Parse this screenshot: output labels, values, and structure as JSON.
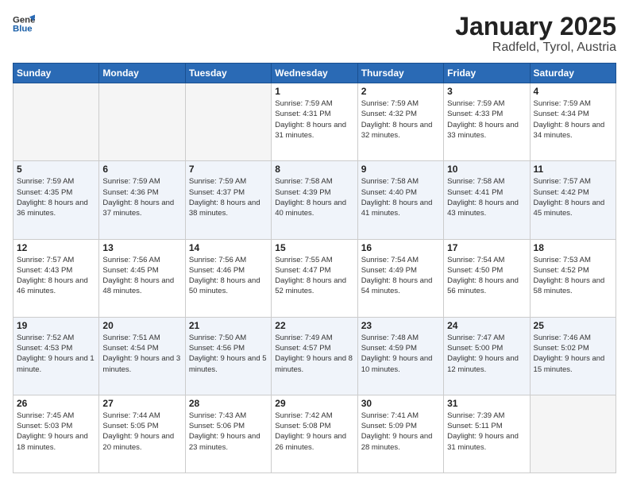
{
  "header": {
    "logo_line1": "General",
    "logo_line2": "Blue",
    "title": "January 2025",
    "subtitle": "Radfeld, Tyrol, Austria"
  },
  "days_of_week": [
    "Sunday",
    "Monday",
    "Tuesday",
    "Wednesday",
    "Thursday",
    "Friday",
    "Saturday"
  ],
  "weeks": [
    [
      {
        "day": "",
        "info": ""
      },
      {
        "day": "",
        "info": ""
      },
      {
        "day": "",
        "info": ""
      },
      {
        "day": "1",
        "info": "Sunrise: 7:59 AM\nSunset: 4:31 PM\nDaylight: 8 hours\nand 31 minutes."
      },
      {
        "day": "2",
        "info": "Sunrise: 7:59 AM\nSunset: 4:32 PM\nDaylight: 8 hours\nand 32 minutes."
      },
      {
        "day": "3",
        "info": "Sunrise: 7:59 AM\nSunset: 4:33 PM\nDaylight: 8 hours\nand 33 minutes."
      },
      {
        "day": "4",
        "info": "Sunrise: 7:59 AM\nSunset: 4:34 PM\nDaylight: 8 hours\nand 34 minutes."
      }
    ],
    [
      {
        "day": "5",
        "info": "Sunrise: 7:59 AM\nSunset: 4:35 PM\nDaylight: 8 hours\nand 36 minutes."
      },
      {
        "day": "6",
        "info": "Sunrise: 7:59 AM\nSunset: 4:36 PM\nDaylight: 8 hours\nand 37 minutes."
      },
      {
        "day": "7",
        "info": "Sunrise: 7:59 AM\nSunset: 4:37 PM\nDaylight: 8 hours\nand 38 minutes."
      },
      {
        "day": "8",
        "info": "Sunrise: 7:58 AM\nSunset: 4:39 PM\nDaylight: 8 hours\nand 40 minutes."
      },
      {
        "day": "9",
        "info": "Sunrise: 7:58 AM\nSunset: 4:40 PM\nDaylight: 8 hours\nand 41 minutes."
      },
      {
        "day": "10",
        "info": "Sunrise: 7:58 AM\nSunset: 4:41 PM\nDaylight: 8 hours\nand 43 minutes."
      },
      {
        "day": "11",
        "info": "Sunrise: 7:57 AM\nSunset: 4:42 PM\nDaylight: 8 hours\nand 45 minutes."
      }
    ],
    [
      {
        "day": "12",
        "info": "Sunrise: 7:57 AM\nSunset: 4:43 PM\nDaylight: 8 hours\nand 46 minutes."
      },
      {
        "day": "13",
        "info": "Sunrise: 7:56 AM\nSunset: 4:45 PM\nDaylight: 8 hours\nand 48 minutes."
      },
      {
        "day": "14",
        "info": "Sunrise: 7:56 AM\nSunset: 4:46 PM\nDaylight: 8 hours\nand 50 minutes."
      },
      {
        "day": "15",
        "info": "Sunrise: 7:55 AM\nSunset: 4:47 PM\nDaylight: 8 hours\nand 52 minutes."
      },
      {
        "day": "16",
        "info": "Sunrise: 7:54 AM\nSunset: 4:49 PM\nDaylight: 8 hours\nand 54 minutes."
      },
      {
        "day": "17",
        "info": "Sunrise: 7:54 AM\nSunset: 4:50 PM\nDaylight: 8 hours\nand 56 minutes."
      },
      {
        "day": "18",
        "info": "Sunrise: 7:53 AM\nSunset: 4:52 PM\nDaylight: 8 hours\nand 58 minutes."
      }
    ],
    [
      {
        "day": "19",
        "info": "Sunrise: 7:52 AM\nSunset: 4:53 PM\nDaylight: 9 hours\nand 1 minute."
      },
      {
        "day": "20",
        "info": "Sunrise: 7:51 AM\nSunset: 4:54 PM\nDaylight: 9 hours\nand 3 minutes."
      },
      {
        "day": "21",
        "info": "Sunrise: 7:50 AM\nSunset: 4:56 PM\nDaylight: 9 hours\nand 5 minutes."
      },
      {
        "day": "22",
        "info": "Sunrise: 7:49 AM\nSunset: 4:57 PM\nDaylight: 9 hours\nand 8 minutes."
      },
      {
        "day": "23",
        "info": "Sunrise: 7:48 AM\nSunset: 4:59 PM\nDaylight: 9 hours\nand 10 minutes."
      },
      {
        "day": "24",
        "info": "Sunrise: 7:47 AM\nSunset: 5:00 PM\nDaylight: 9 hours\nand 12 minutes."
      },
      {
        "day": "25",
        "info": "Sunrise: 7:46 AM\nSunset: 5:02 PM\nDaylight: 9 hours\nand 15 minutes."
      }
    ],
    [
      {
        "day": "26",
        "info": "Sunrise: 7:45 AM\nSunset: 5:03 PM\nDaylight: 9 hours\nand 18 minutes."
      },
      {
        "day": "27",
        "info": "Sunrise: 7:44 AM\nSunset: 5:05 PM\nDaylight: 9 hours\nand 20 minutes."
      },
      {
        "day": "28",
        "info": "Sunrise: 7:43 AM\nSunset: 5:06 PM\nDaylight: 9 hours\nand 23 minutes."
      },
      {
        "day": "29",
        "info": "Sunrise: 7:42 AM\nSunset: 5:08 PM\nDaylight: 9 hours\nand 26 minutes."
      },
      {
        "day": "30",
        "info": "Sunrise: 7:41 AM\nSunset: 5:09 PM\nDaylight: 9 hours\nand 28 minutes."
      },
      {
        "day": "31",
        "info": "Sunrise: 7:39 AM\nSunset: 5:11 PM\nDaylight: 9 hours\nand 31 minutes."
      },
      {
        "day": "",
        "info": ""
      }
    ]
  ]
}
